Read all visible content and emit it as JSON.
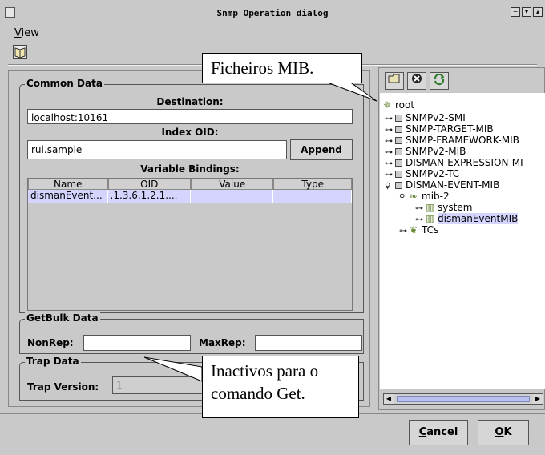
{
  "window": {
    "title": "Snmp Operation dialog",
    "controls": [
      "minimize-icon",
      "maximize-icon",
      "close-icon"
    ]
  },
  "menubar": {
    "items": [
      {
        "label": "View",
        "mnemonic": "V"
      }
    ]
  },
  "toolbar": {
    "icons": [
      "book-icon"
    ]
  },
  "common_data": {
    "group_title": "Common Data",
    "destination_label": "Destination:",
    "destination_value": "localhost:10161",
    "index_oid_label": "Index OID:",
    "index_oid_value": "rui.sample",
    "append_label": "Append",
    "bindings_label": "Variable Bindings:",
    "table": {
      "columns": [
        "Name",
        "OID",
        "Value",
        "Type"
      ],
      "rows": [
        [
          "dismanEvent...",
          ".1.3.6.1.2.1....",
          "",
          ""
        ]
      ]
    }
  },
  "getbulk": {
    "group_title": "GetBulk Data",
    "nonrep_label": "NonRep:",
    "nonrep_value": "",
    "maxrep_label": "MaxRep:",
    "maxrep_value": ""
  },
  "trap": {
    "group_title": "Trap Data",
    "version_label": "Trap Version:",
    "version_value": "1"
  },
  "mib_tree": {
    "toolbar_icons": [
      "open-folder-icon",
      "close-circle-icon",
      "refresh-icon"
    ],
    "root_label": "root",
    "items": [
      {
        "label": "SNMPv2-SMI"
      },
      {
        "label": "SNMP-TARGET-MIB"
      },
      {
        "label": "SNMP-FRAMEWORK-MIB"
      },
      {
        "label": "SNMPv2-MIB"
      },
      {
        "label": "DISMAN-EXPRESSION-MI"
      },
      {
        "label": "SNMPv2-TC"
      },
      {
        "label": "DISMAN-EVENT-MIB"
      },
      {
        "label": "mib-2"
      },
      {
        "label": "system"
      },
      {
        "label": "dismanEventMIB",
        "selected": true
      },
      {
        "label": "TCs"
      }
    ]
  },
  "buttons": {
    "cancel": {
      "label": "ancel",
      "mnemonic": "C"
    },
    "ok": {
      "label": "K",
      "mnemonic": "O"
    }
  },
  "callouts": {
    "top": "Ficheiros MIB.",
    "bottom_line1": "Inactivos para o",
    "bottom_line2": "comando Get."
  }
}
